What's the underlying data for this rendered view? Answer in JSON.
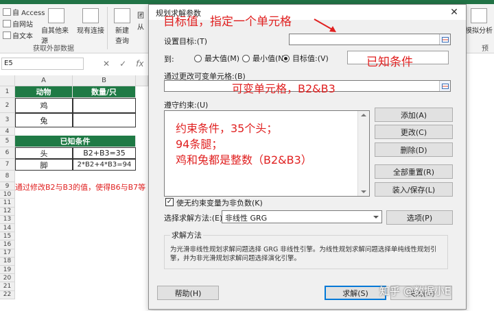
{
  "ribbon": {
    "small_items": [
      "自 Access",
      "自网站",
      "自文本"
    ],
    "big_items": [
      "自其他来源",
      "现有连接",
      "新建\n查询"
    ],
    "partial_items": [
      "团",
      "从"
    ],
    "group_label": "获取外部数据",
    "right_label": "模拟分析",
    "right_group_label": "预"
  },
  "formula_bar": {
    "name_box": "E5",
    "fx": "fx"
  },
  "grid": {
    "col_headers": [
      "A",
      "B"
    ],
    "row_headers": [
      "1",
      "2",
      "3",
      "4",
      "5",
      "6",
      "7",
      "8",
      "9",
      "10",
      "11",
      "12",
      "13",
      "14",
      "15",
      "16",
      "17",
      "18",
      "19",
      "20",
      "21",
      "22"
    ],
    "header_row": [
      "动物",
      "数量/只"
    ],
    "animals": [
      "鸡",
      "兔"
    ],
    "known_title": "已知条件",
    "known_rows": [
      [
        "头",
        "B2+B3=35"
      ],
      [
        "脚",
        "2*B2+4*B3=94"
      ]
    ],
    "note": "通过修改B2与B3的值，使得B6与B7等"
  },
  "dialog": {
    "title": "规划求解参数",
    "close": "✕",
    "objective_label": "设置目标:(T)",
    "objective_value": "",
    "to_label": "到:",
    "radio_max": "最大值(M)",
    "radio_min": "最小值(N)",
    "radio_value": "目标值:(V)",
    "target_value": "",
    "variable_label": "通过更改可变单元格:(B)",
    "variable_value": "",
    "constraints_label": "遵守约束:(U)",
    "btn_add": "添加(A)",
    "btn_change": "更改(C)",
    "btn_delete": "删除(D)",
    "btn_reset": "全部重置(R)",
    "btn_load": "装入/保存(L)",
    "nonneg_label": "使无约束变量为非负数(K)",
    "nonneg_checked": "✓",
    "method_label": "选择求解方法:(E)",
    "method_value": "非线性 GRG",
    "btn_options": "选项(P)",
    "method_group_title": "求解方法",
    "method_desc": "为光滑非线性规划求解问题选择 GRG 非线性引擎。为线性规划求解问题选择单纯线性规划引擎，并为非光滑规划求解问题选择演化引擎。",
    "btn_help": "帮助(H)",
    "btn_solve": "求解(S)",
    "btn_close": "关闭(O)"
  },
  "annotations": {
    "target": "目标值，指定一个单元格",
    "known": "已知条件",
    "variable": "可变单元格，B2&B3",
    "constraints": "约束条件，35个头；\n94条腿；\n鸡和兔都是整数（B2&B3）",
    "arrow_color": "#e02020"
  },
  "watermark": "知乎 @数据小E",
  "colors": {
    "header_green": "#1f7a45",
    "annotation_red": "#e02020",
    "ribbon_green": "#217346"
  }
}
